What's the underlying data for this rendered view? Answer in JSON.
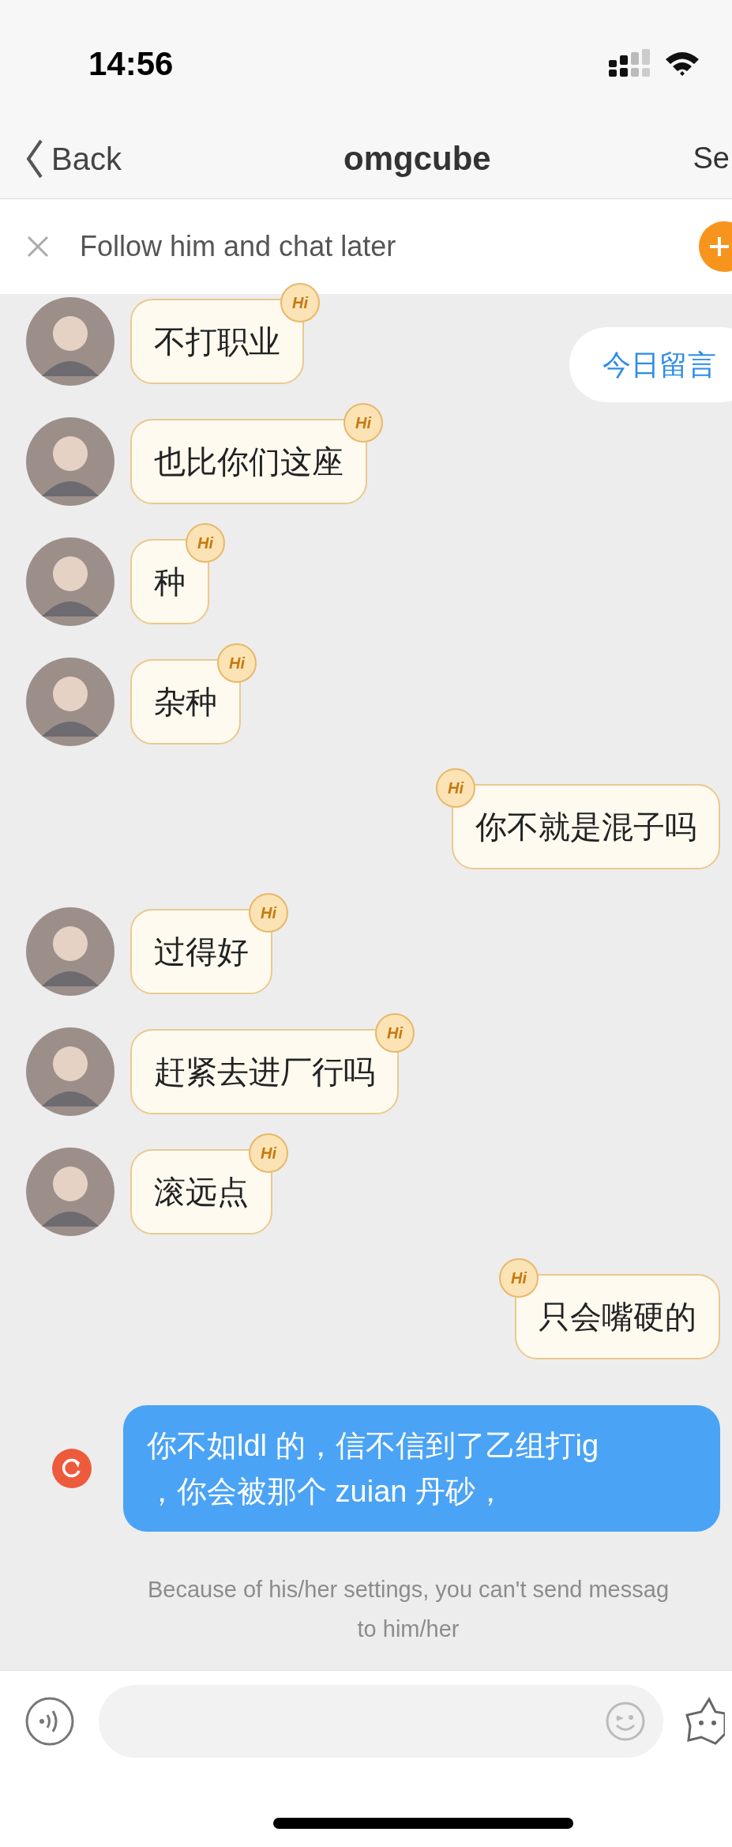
{
  "status_bar": {
    "time": "14:56"
  },
  "nav": {
    "back": "Back",
    "title": "omgcube",
    "action": "Se"
  },
  "follow_banner": {
    "text": "Follow him and chat later"
  },
  "floating_pill": {
    "text": "今日留言"
  },
  "messages": [
    {
      "outgoing": false,
      "kind": "greeting",
      "badge": "Hi",
      "lines": [
        "不打职业"
      ],
      "failed": false
    },
    {
      "outgoing": false,
      "kind": "greeting",
      "badge": "Hi",
      "lines": [
        "也比你们这座"
      ],
      "failed": false
    },
    {
      "outgoing": false,
      "kind": "greeting",
      "badge": "Hi",
      "lines": [
        "种"
      ],
      "failed": false
    },
    {
      "outgoing": false,
      "kind": "greeting",
      "badge": "Hi",
      "lines": [
        "杂种"
      ],
      "failed": false
    },
    {
      "outgoing": true,
      "kind": "greeting",
      "badge": "Hi",
      "lines": [
        "你不就是混子吗"
      ],
      "failed": false
    },
    {
      "outgoing": false,
      "kind": "greeting",
      "badge": "Hi",
      "lines": [
        "过得好"
      ],
      "failed": false
    },
    {
      "outgoing": false,
      "kind": "greeting",
      "badge": "Hi",
      "lines": [
        "赶紧去进厂行吗"
      ],
      "failed": false
    },
    {
      "outgoing": false,
      "kind": "greeting",
      "badge": "Hi",
      "lines": [
        "滚远点"
      ],
      "failed": false
    },
    {
      "outgoing": true,
      "kind": "greeting",
      "badge": "Hi",
      "lines": [
        "只会嘴硬的"
      ],
      "failed": false
    },
    {
      "outgoing": true,
      "kind": "text",
      "lines": [
        "你不如ldl 的，信不信到了乙组打ig",
        "，你会被那个 zuian 丹砂，"
      ],
      "failed": true
    }
  ],
  "notice": {
    "lines": [
      "Because of his/her settings, you can't send messag",
      "to him/her"
    ]
  }
}
